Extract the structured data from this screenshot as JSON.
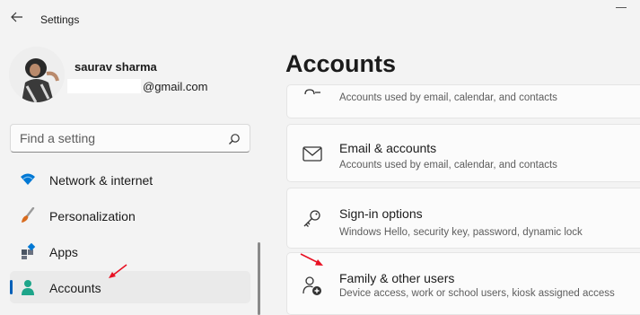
{
  "window": {
    "title": "Settings",
    "back_icon": "arrow-left-icon",
    "minimize_icon": "minimize-icon"
  },
  "profile": {
    "name": "saurav sharma",
    "email_domain": "@gmail.com",
    "avatar_icon": "user-photo-avatar"
  },
  "search": {
    "placeholder": "Find a setting",
    "icon": "search-icon"
  },
  "nav": {
    "items": [
      {
        "label": "Network & internet",
        "icon": "wifi-icon",
        "icon_color": "#0078d4"
      },
      {
        "label": "Personalization",
        "icon": "paintbrush-icon",
        "icon_color": "#d86b1d"
      },
      {
        "label": "Apps",
        "icon": "apps-icon",
        "icon_color": "#4b5563"
      },
      {
        "label": "Accounts",
        "icon": "person-icon",
        "icon_color": "#1ea58a",
        "active": true
      }
    ]
  },
  "main": {
    "title": "Accounts",
    "cards": [
      {
        "title": "",
        "description": "Accounts used by email, calendar, and contacts",
        "icon": "accounts-list-icon"
      },
      {
        "title": "Email & accounts",
        "description": "Accounts used by email, calendar, and contacts",
        "icon": "mail-icon"
      },
      {
        "title": "Sign-in options",
        "description": "Windows Hello, security key, password, dynamic lock",
        "icon": "key-icon"
      },
      {
        "title": "Family & other users",
        "description": "Device access, work or school users, kiosk assigned access",
        "icon": "add-person-icon"
      }
    ]
  },
  "annotations": {
    "arrow_color": "#e81123",
    "arrows": [
      "accounts-nav-arrow",
      "family-users-arrow"
    ]
  },
  "colors": {
    "accent": "#005fb8",
    "background": "#f3f3f3",
    "card": "#fbfbfb"
  }
}
